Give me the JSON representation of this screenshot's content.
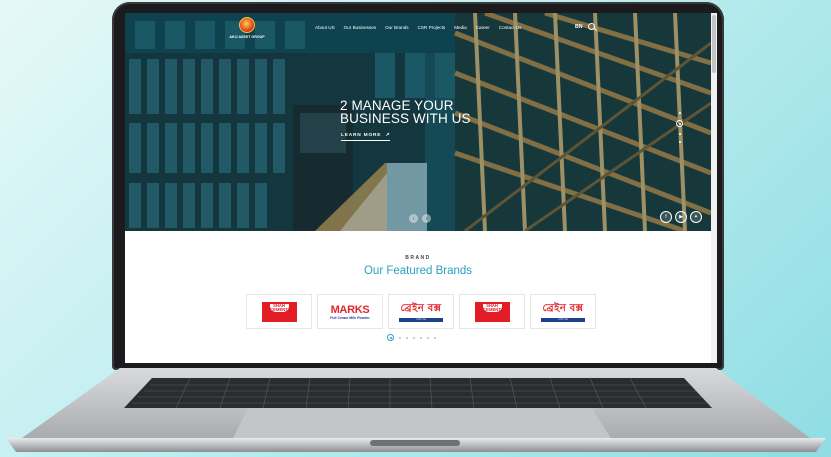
{
  "site": {
    "logo_text": "AKIJ ASSET GROUP"
  },
  "nav": {
    "items": [
      {
        "label": "About US"
      },
      {
        "label": "Our Businesses"
      },
      {
        "label": "Our Brands"
      },
      {
        "label": "CSR Projects"
      },
      {
        "label": "Media"
      },
      {
        "label": "Career"
      },
      {
        "label": "Contact Us"
      }
    ],
    "lang": "BN"
  },
  "hero": {
    "headline": "2 MANAGE YOUR\nBUSINESS WITH US",
    "cta": "LEARN MORE"
  },
  "brands": {
    "eyebrow": "BRAND",
    "title": "Our Featured Brands",
    "cards": [
      {
        "name": "SHAH CEMENT"
      },
      {
        "name": "MARKS",
        "sub": "Full Cream Milk Powder"
      },
      {
        "name": "ব্রেইন বক্স",
        "bar": "ব্রেইন বক্স"
      },
      {
        "name": "SHAH CEMENT"
      },
      {
        "name": "ব্রেইন বক্স",
        "bar": "ব্রেইন বক্স"
      }
    ]
  },
  "colors": {
    "accent": "#2aa0c2",
    "brand_red": "#e31d25",
    "hero_dark": "#0e4a58"
  },
  "icons": [
    "search-icon",
    "facebook-icon",
    "youtube-icon",
    "twitter-icon",
    "prev-arrow-icon",
    "next-arrow-icon"
  ]
}
